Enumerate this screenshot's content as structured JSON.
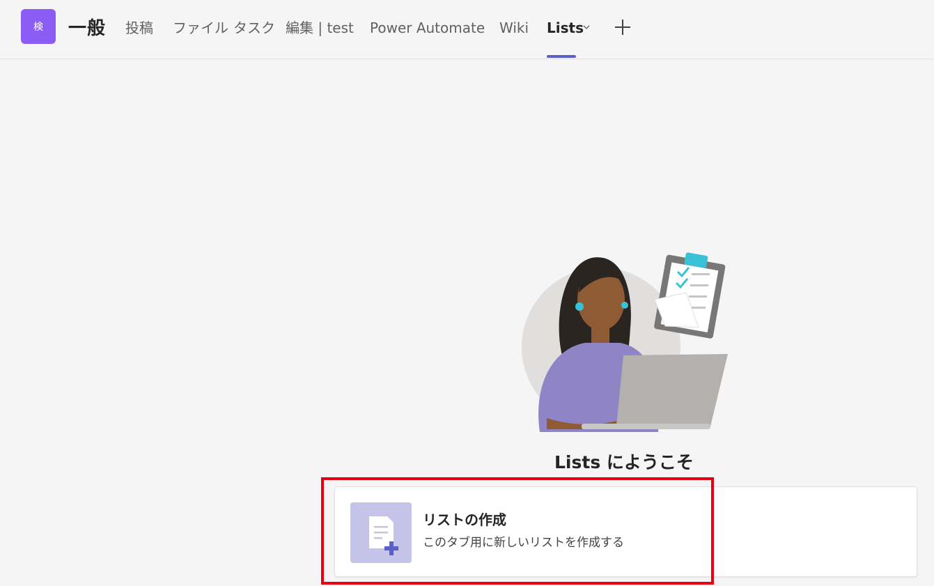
{
  "header": {
    "team_avatar_text": "検",
    "channel_name": "一般",
    "tabs": [
      {
        "label": "投稿"
      },
      {
        "label": "ファイル"
      },
      {
        "label": "タスク"
      },
      {
        "label": "編集 | test"
      },
      {
        "label": "Power Automate"
      },
      {
        "label": "Wiki"
      },
      {
        "label": "Lists",
        "active": true
      }
    ]
  },
  "main": {
    "welcome_title": "Lists にようこそ",
    "create_card": {
      "title": "リストの作成",
      "description": "このタブ用に新しいリストを作成する",
      "icon": "new-list-icon"
    }
  },
  "colors": {
    "accent": "#5b5fc7",
    "team_avatar": "#8b5cf6",
    "card_icon_bg": "#c5c3e8",
    "highlight": "#e60012"
  }
}
